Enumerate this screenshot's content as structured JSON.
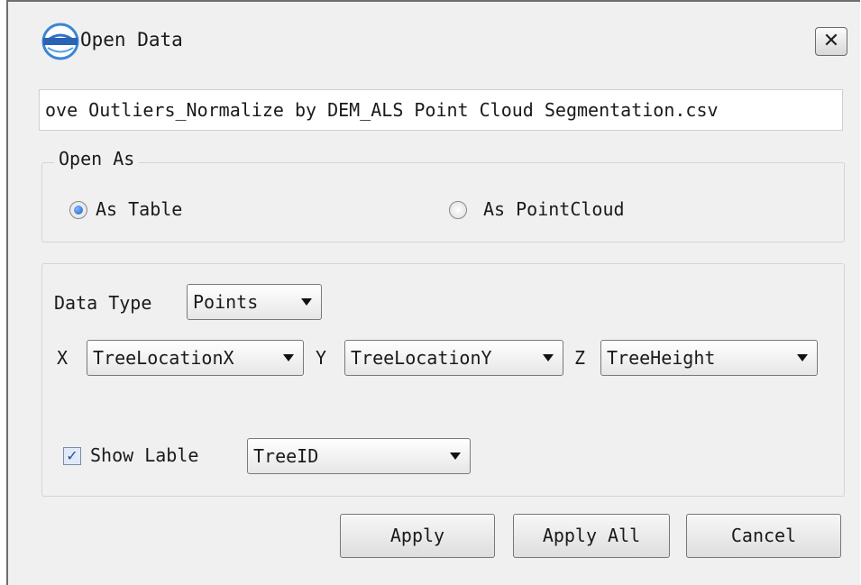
{
  "dialog": {
    "title": "Open Data",
    "app_icon": "lidar360-logo",
    "close_icon": "close-icon",
    "close_label": "✕"
  },
  "file_path": "ove Outliers_Normalize by DEM_ALS Point Cloud Segmentation.csv",
  "open_as": {
    "legend": "Open As",
    "options": [
      {
        "label": "As Table",
        "checked": true
      },
      {
        "label": "As PointCloud",
        "checked": false
      }
    ]
  },
  "data_settings": {
    "data_type_label": "Data Type",
    "data_type_value": "Points",
    "x_label": "X",
    "x_value": "TreeLocationX",
    "y_label": "Y",
    "y_value": "TreeLocationY",
    "z_label": "Z",
    "z_value": "TreeHeight",
    "show_label_text": "Show Lable",
    "show_label_checked": true,
    "label_field_value": "TreeID"
  },
  "buttons": {
    "apply": "Apply",
    "apply_all": "Apply All",
    "cancel": "Cancel"
  },
  "colors": {
    "window_bg": "#f0f0f0",
    "radio_selected": "#1d5fc4",
    "checkbox_fill": "#dfe9f8"
  }
}
